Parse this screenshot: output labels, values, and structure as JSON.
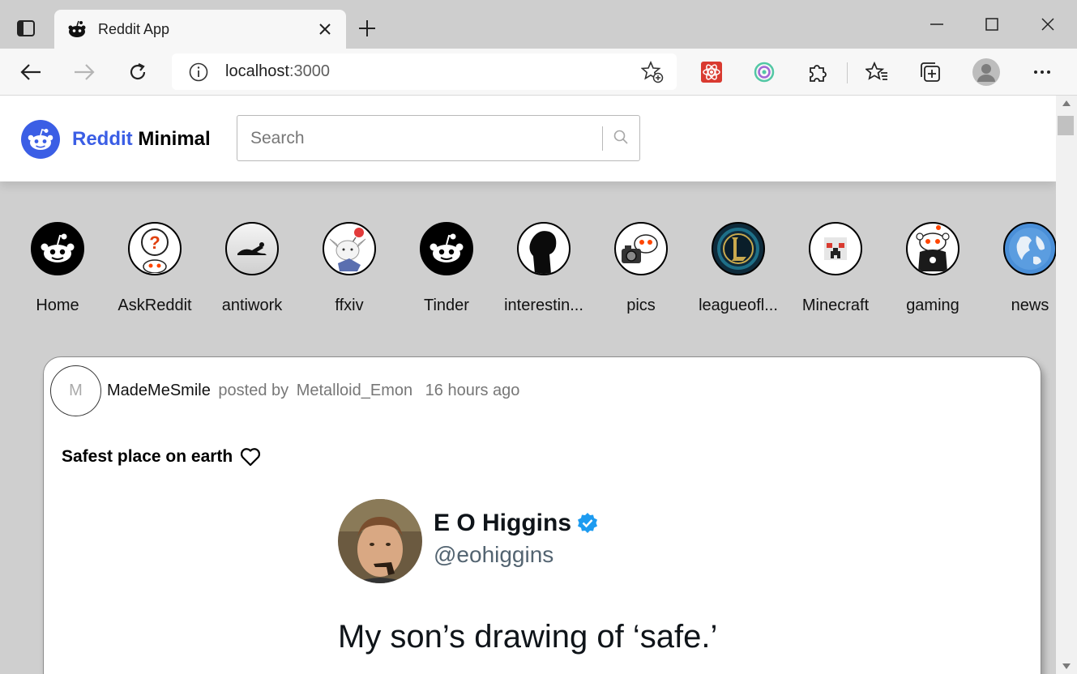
{
  "browser": {
    "tab_title": "Reddit App",
    "address_host": "localhost",
    "address_port": ":3000"
  },
  "header": {
    "brand_part1": "Reddit",
    "brand_part2": "Minimal",
    "search_placeholder": "Search"
  },
  "subreddits": [
    {
      "name": "Home",
      "icon": "reddit-snoo-icon"
    },
    {
      "name": "AskReddit",
      "icon": "askreddit-icon"
    },
    {
      "name": "antiwork",
      "icon": "antiwork-icon"
    },
    {
      "name": "ffxiv",
      "icon": "moogle-icon"
    },
    {
      "name": "Tinder",
      "icon": "reddit-snoo-icon"
    },
    {
      "name": "interestin...",
      "icon": "silhouette-icon"
    },
    {
      "name": "pics",
      "icon": "camera-snoo-icon"
    },
    {
      "name": "leagueofl...",
      "icon": "league-logo-icon"
    },
    {
      "name": "Minecraft",
      "icon": "creeper-icon"
    },
    {
      "name": "gaming",
      "icon": "gaming-snoo-icon"
    },
    {
      "name": "news",
      "icon": "globe-icon"
    }
  ],
  "post": {
    "avatar_letter": "M",
    "subreddit": "MadeMeSmile",
    "posted_by_label": "posted by",
    "author": "Metalloid_Emon",
    "time": "16 hours ago",
    "title": "Safest place on earth",
    "tweet": {
      "name": "E O Higgins",
      "handle": "@eohiggins",
      "text": "My son’s drawing of ‘safe.’"
    }
  },
  "colors": {
    "brand_blue": "#3b5ee5",
    "page_bg": "#cfcfcf",
    "verified_blue": "#1d9bf0"
  }
}
